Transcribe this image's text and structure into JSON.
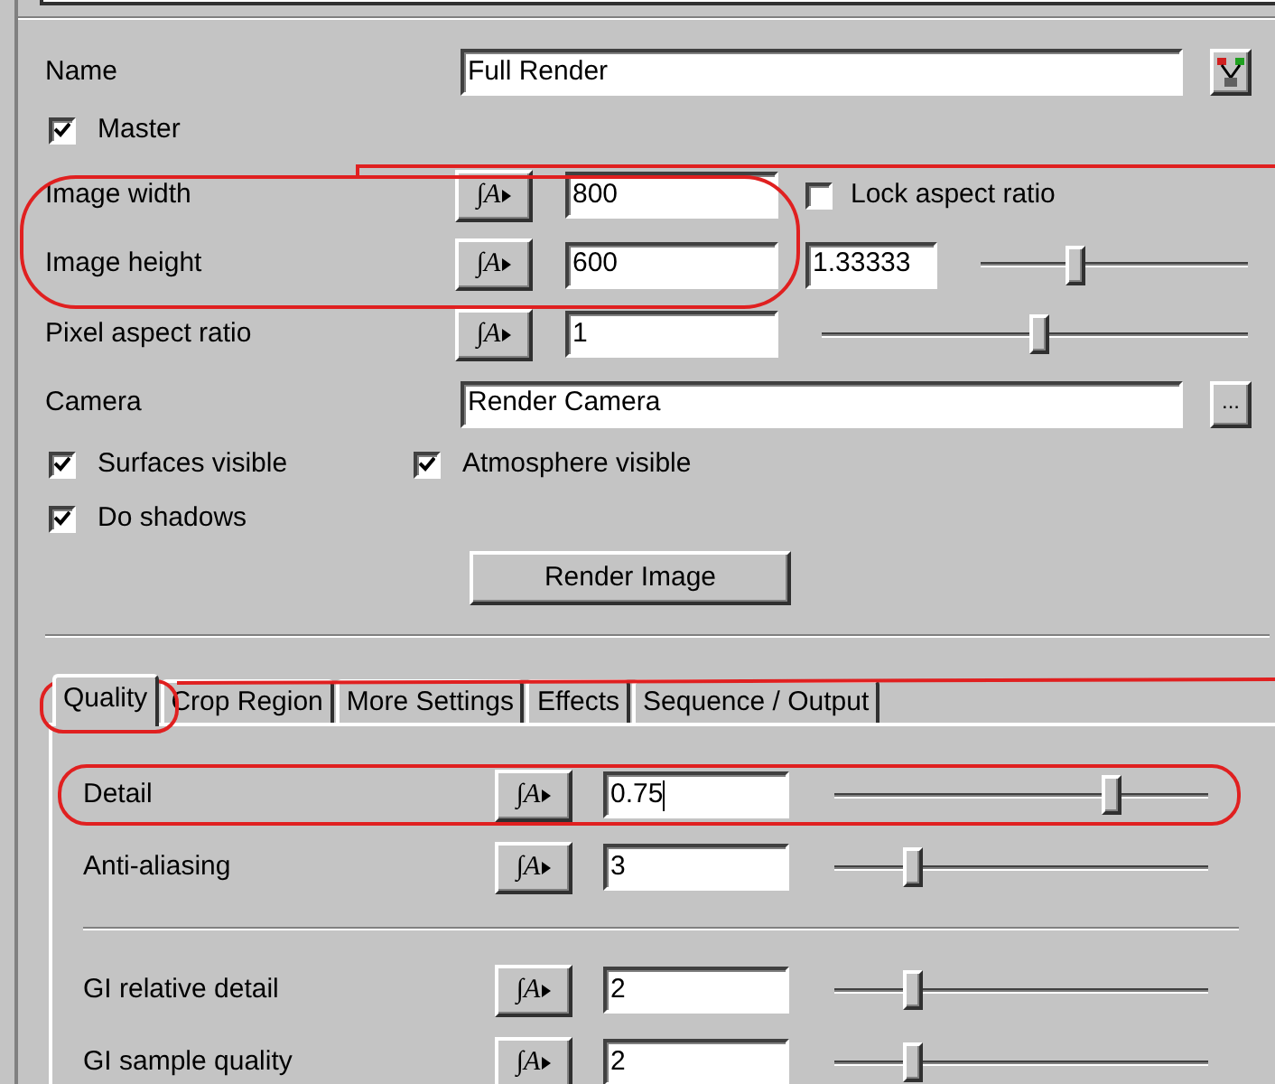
{
  "name": {
    "label": "Name",
    "value": "Full Render"
  },
  "master": {
    "label": "Master",
    "checked": true
  },
  "image_width": {
    "label": "Image width",
    "animate": "∫A",
    "value": "800"
  },
  "lock_aspect_ratio": {
    "label": "Lock aspect ratio",
    "checked": false
  },
  "image_height": {
    "label": "Image height",
    "animate": "∫A",
    "value": "600"
  },
  "aspect_ratio": {
    "value": "1.33333",
    "level": 0.35
  },
  "pixel_aspect_ratio": {
    "label": "Pixel aspect ratio",
    "animate": "∫A",
    "value": "1",
    "level": 0.51
  },
  "camera": {
    "label": "Camera",
    "value": "Render Camera",
    "browse_button": "..."
  },
  "checkboxes": [
    {
      "label": "Surfaces visible",
      "checked": true
    },
    {
      "label": "Atmosphere visible",
      "checked": true
    },
    {
      "label": "Do shadows",
      "checked": true
    }
  ],
  "render_button": "Render Image",
  "tabs": [
    {
      "label": "Quality",
      "selected": true
    },
    {
      "label": "Crop Region",
      "selected": false
    },
    {
      "label": "More Settings",
      "selected": false
    },
    {
      "label": "Effects",
      "selected": false
    },
    {
      "label": "Sequence / Output",
      "selected": false
    }
  ],
  "quality_groups": [
    [
      {
        "label": "Detail",
        "animate": "∫A",
        "value": "0.75",
        "focused": true,
        "level": 0.74
      },
      {
        "label": "Anti-aliasing",
        "animate": "∫A",
        "value": "3",
        "focused": false,
        "level": 0.21
      }
    ],
    [
      {
        "label": "GI relative detail",
        "animate": "∫A",
        "value": "2",
        "focused": false,
        "level": 0.21
      },
      {
        "label": "GI sample quality",
        "animate": "∫A",
        "value": "2",
        "focused": false,
        "level": 0.21
      }
    ]
  ]
}
